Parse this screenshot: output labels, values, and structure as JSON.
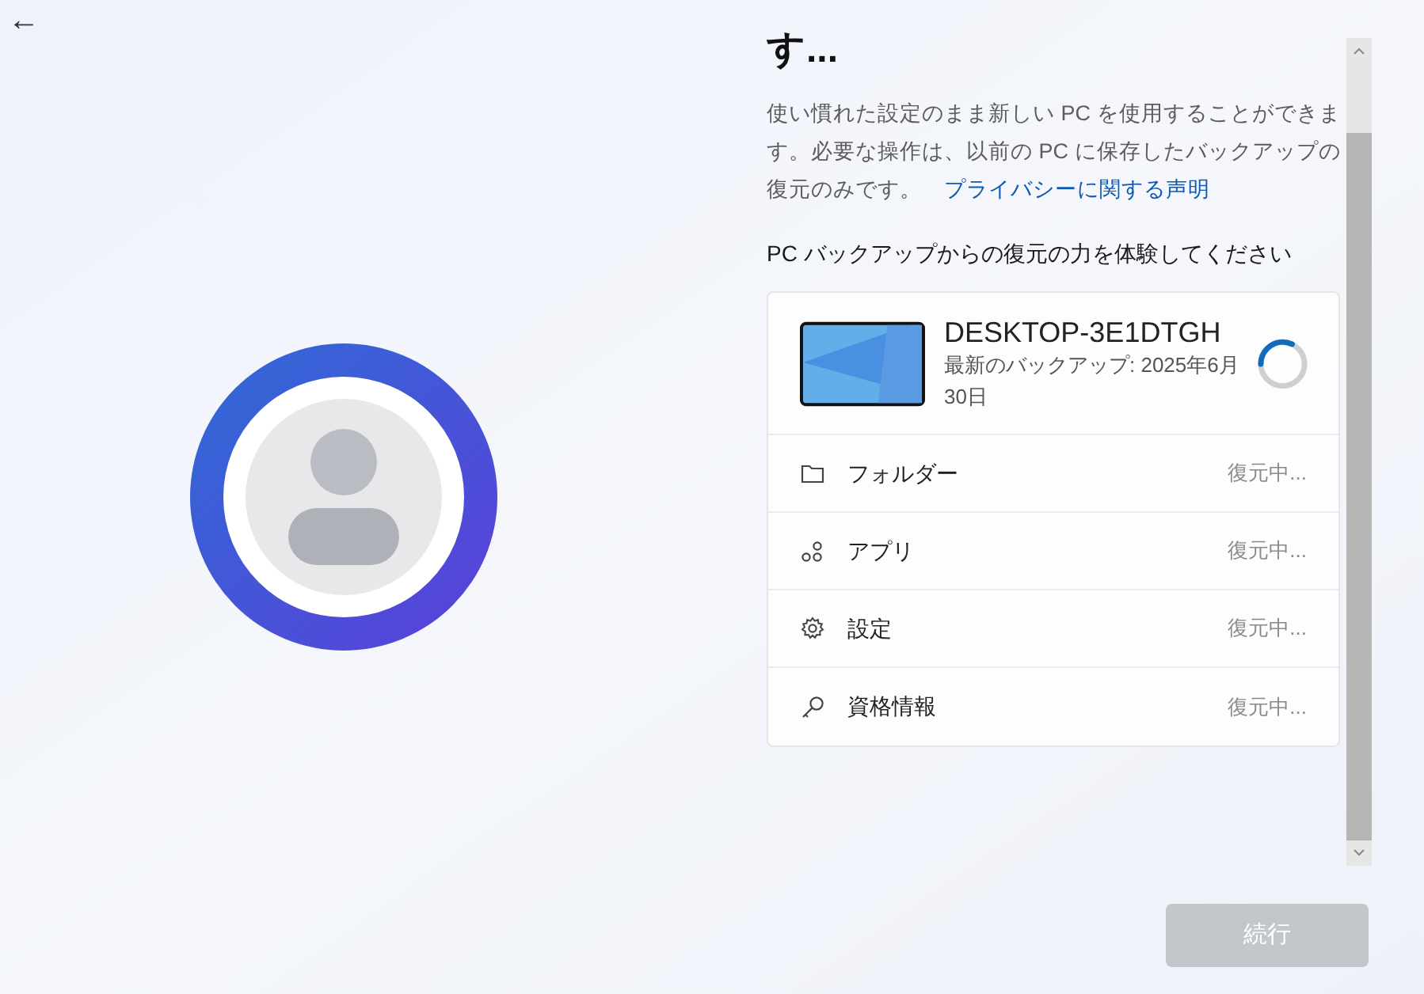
{
  "back_button": {
    "label": "←"
  },
  "heading": "す...",
  "description": "使い慣れた設定のまま新しい PC を使用することができます。必要な操作は、以前の PC に保存したバックアップの復元のみです。",
  "privacy_link": "プライバシーに関する声明",
  "subheading": "PC バックアップからの復元の力を体験してください",
  "device": {
    "name": "DESKTOP-3E1DTGH",
    "backup_line1": "最新のバックアップ: 2025年6月",
    "backup_line2": "30日"
  },
  "items": [
    {
      "kind": "folder",
      "label": "フォルダー",
      "status": "復元中..."
    },
    {
      "kind": "apps",
      "label": "アプリ",
      "status": "復元中..."
    },
    {
      "kind": "settings",
      "label": "設定",
      "status": "復元中..."
    },
    {
      "kind": "key",
      "label": "資格情報",
      "status": "復元中..."
    }
  ],
  "continue_button": {
    "label": "続行",
    "disabled": true
  }
}
